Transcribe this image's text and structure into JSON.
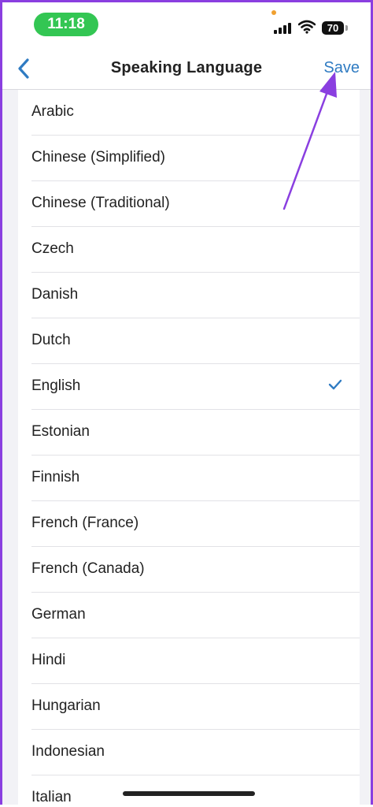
{
  "status_bar": {
    "time": "11:18",
    "battery": "70"
  },
  "nav": {
    "title": "Speaking Language",
    "save_label": "Save"
  },
  "languages": [
    {
      "label": "Arabic",
      "selected": false
    },
    {
      "label": "Chinese (Simplified)",
      "selected": false
    },
    {
      "label": "Chinese (Traditional)",
      "selected": false
    },
    {
      "label": "Czech",
      "selected": false
    },
    {
      "label": "Danish",
      "selected": false
    },
    {
      "label": "Dutch",
      "selected": false
    },
    {
      "label": "English",
      "selected": true
    },
    {
      "label": "Estonian",
      "selected": false
    },
    {
      "label": "Finnish",
      "selected": false
    },
    {
      "label": "French (France)",
      "selected": false
    },
    {
      "label": "French (Canada)",
      "selected": false
    },
    {
      "label": "German",
      "selected": false
    },
    {
      "label": "Hindi",
      "selected": false
    },
    {
      "label": "Hungarian",
      "selected": false
    },
    {
      "label": "Indonesian",
      "selected": false
    },
    {
      "label": "Italian",
      "selected": false
    }
  ],
  "colors": {
    "accent": "#2f7bc2",
    "annotation": "#8a3fe0",
    "time_pill": "#33c653"
  }
}
